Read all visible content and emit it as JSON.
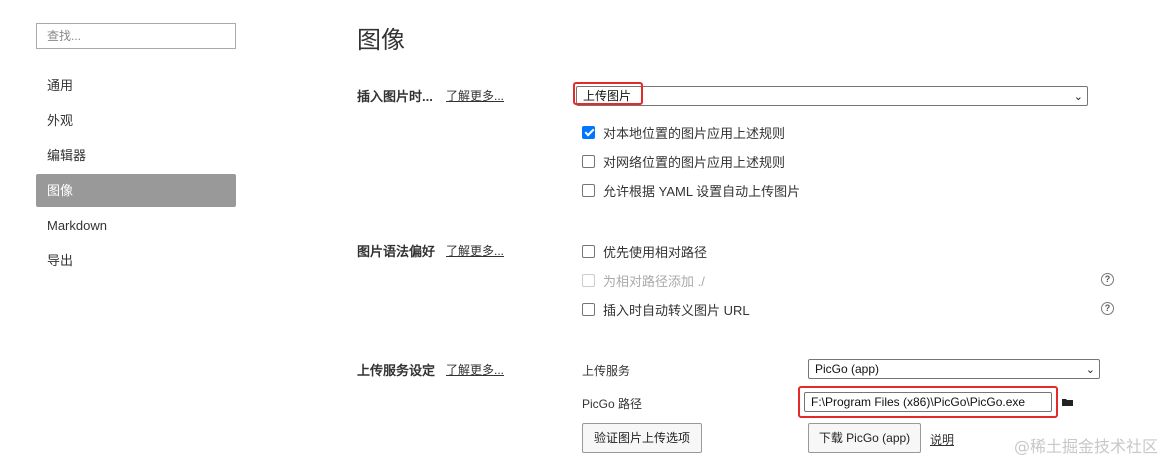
{
  "search": {
    "placeholder": "查找..."
  },
  "sidebar": {
    "items": [
      {
        "label": "通用"
      },
      {
        "label": "外观"
      },
      {
        "label": "编辑器"
      },
      {
        "label": "图像"
      },
      {
        "label": "Markdown"
      },
      {
        "label": "导出"
      }
    ]
  },
  "page": {
    "title": "图像"
  },
  "insert_image": {
    "title": "插入图片时...",
    "learn_more": "了解更多...",
    "selected": "上传图片",
    "options": [
      {
        "label": "对本地位置的图片应用上述规则",
        "checked": true
      },
      {
        "label": "对网络位置的图片应用上述规则",
        "checked": false
      },
      {
        "label": "允许根据 YAML 设置自动上传图片",
        "checked": false
      }
    ]
  },
  "syntax_pref": {
    "title": "图片语法偏好",
    "learn_more": "了解更多...",
    "options": [
      {
        "label": "优先使用相对路径",
        "checked": false,
        "disabled": false
      },
      {
        "label": "为相对路径添加 ./",
        "checked": false,
        "disabled": true
      },
      {
        "label": "插入时自动转义图片 URL",
        "checked": false,
        "disabled": false
      }
    ]
  },
  "upload": {
    "title": "上传服务设定",
    "learn_more": "了解更多...",
    "service_label": "上传服务",
    "service_value": "PicGo (app)",
    "path_label": "PicGo 路径",
    "path_value": "F:\\Program Files (x86)\\PicGo\\PicGo.exe",
    "verify_button": "验证图片上传选项",
    "download_button": "下载 PicGo (app)",
    "explain_link": "说明"
  },
  "watermark": "@稀土掘金技术社区",
  "colors": {
    "active_nav": "#999999",
    "checkbox": "#0075ff",
    "highlight": "#e52a2a"
  }
}
